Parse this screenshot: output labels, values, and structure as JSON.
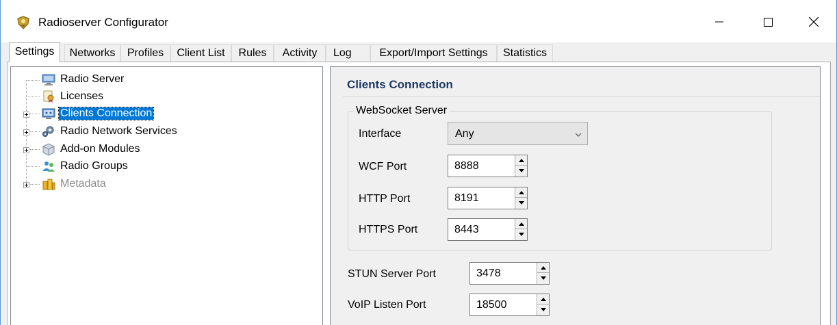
{
  "window": {
    "title": "Radioserver Configurator",
    "controls": [
      "minimize-icon",
      "maximize-icon",
      "close-icon"
    ]
  },
  "tabs": [
    {
      "label": "Settings",
      "active": true
    },
    {
      "label": "Networks",
      "active": false
    },
    {
      "label": "Profiles",
      "active": false
    },
    {
      "label": "Client List",
      "active": false
    },
    {
      "label": "Rules",
      "active": false
    },
    {
      "label": "Activity",
      "active": false
    },
    {
      "label": "Log",
      "active": false
    },
    {
      "label": "Export/Import Settings",
      "active": false
    },
    {
      "label": "Statistics",
      "active": false
    }
  ],
  "tree": {
    "items": [
      {
        "label": "Radio Server",
        "icon": "server-icon",
        "expandable": false
      },
      {
        "label": "Licenses",
        "icon": "license-icon",
        "expandable": false
      },
      {
        "label": "Clients Connection",
        "icon": "clients-icon",
        "expandable": true,
        "selected": true
      },
      {
        "label": "Radio Network Services",
        "icon": "network-services-icon",
        "expandable": true
      },
      {
        "label": "Add-on Modules",
        "icon": "modules-icon",
        "expandable": true
      },
      {
        "label": "Radio Groups",
        "icon": "groups-icon",
        "expandable": false
      },
      {
        "label": "Metadata",
        "icon": "metadata-icon",
        "expandable": true,
        "disabled": true
      }
    ]
  },
  "panel": {
    "title": "Clients Connection",
    "websocket": {
      "legend": "WebSocket Server",
      "interface_label": "Interface",
      "interface_value": "Any",
      "wcf_label": "WCF Port",
      "wcf_value": "8888",
      "http_label": "HTTP Port",
      "http_value": "8191",
      "https_label": "HTTPS Port",
      "https_value": "8443"
    },
    "stun_label": "STUN Server Port",
    "stun_value": "3478",
    "voip_label": "VoIP Listen Port",
    "voip_value": "18500"
  },
  "colors": {
    "accent": "#0078d7",
    "window_border": "#5b9bd5",
    "section_title": "#1f3a67"
  }
}
